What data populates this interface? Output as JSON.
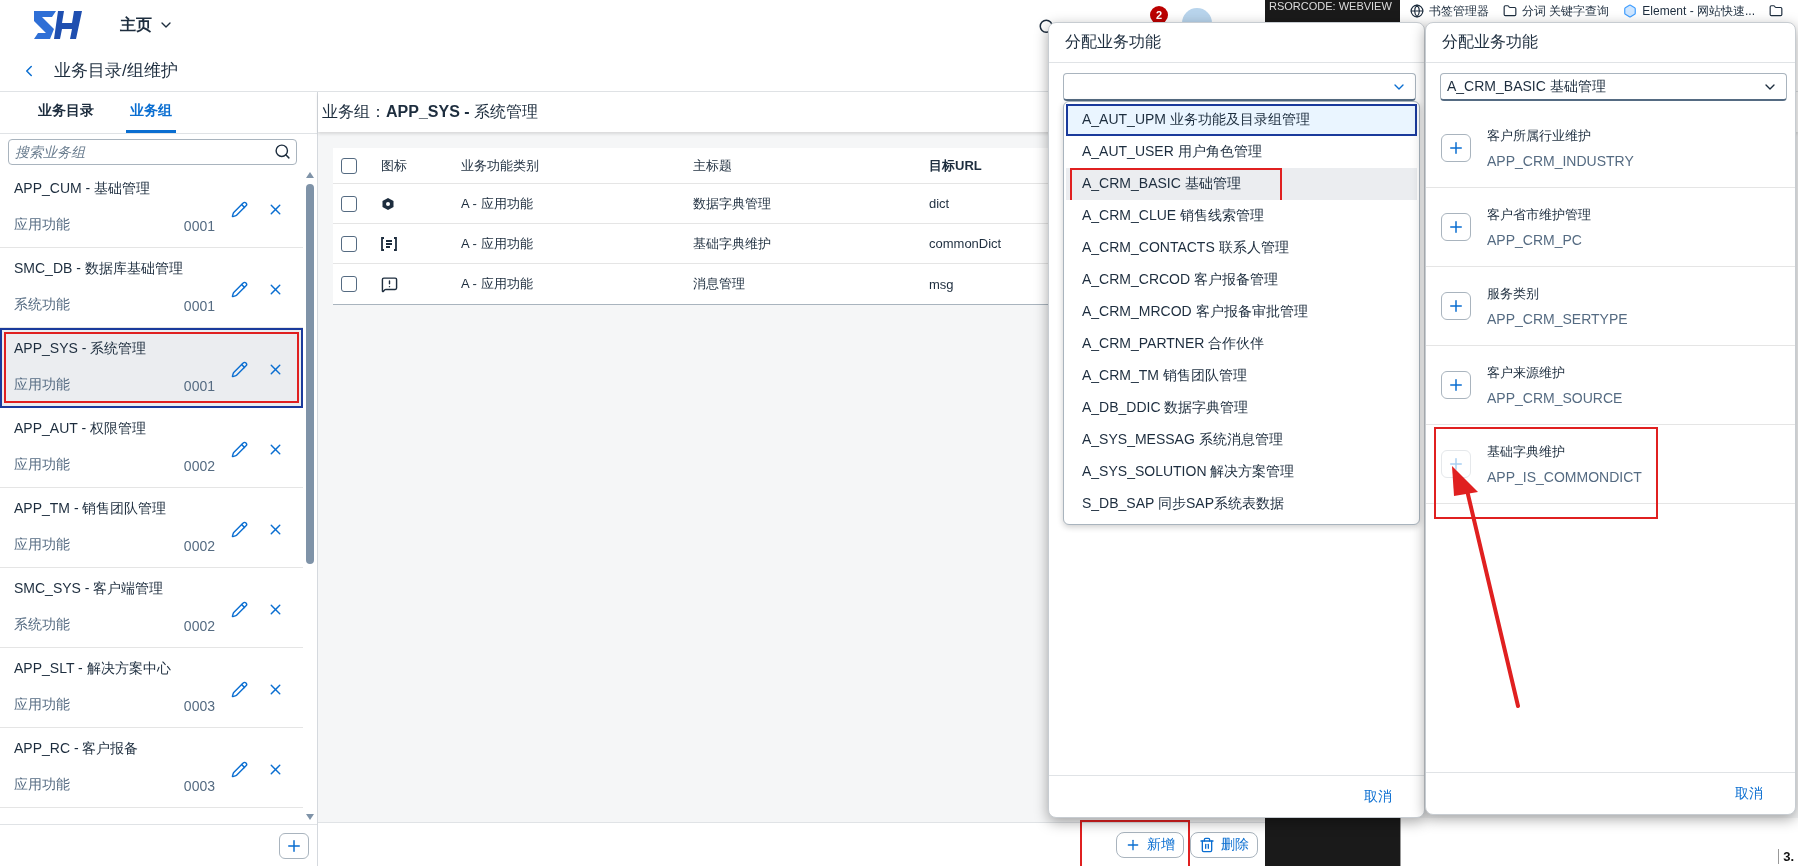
{
  "header": {
    "home_menu": "主页",
    "notification_count": "2"
  },
  "breadcrumb": "业务目录/组维护",
  "sidebar": {
    "tabs": [
      {
        "label": "业务目录",
        "selected": false
      },
      {
        "label": "业务组",
        "selected": true
      }
    ],
    "search": {
      "placeholder": "搜索业务组"
    },
    "items": [
      {
        "title": "APP_CUM - 基础管理",
        "category": "应用功能",
        "code": "0001",
        "selected": false,
        "annotated": false
      },
      {
        "title": "SMC_DB - 数据库基础管理",
        "category": "系统功能",
        "code": "0001",
        "selected": false,
        "annotated": false
      },
      {
        "title": "APP_SYS - 系统管理",
        "category": "应用功能",
        "code": "0001",
        "selected": true,
        "annotated": true
      },
      {
        "title": "APP_AUT - 权限管理",
        "category": "应用功能",
        "code": "0002",
        "selected": false,
        "annotated": false
      },
      {
        "title": "APP_TM - 销售团队管理",
        "category": "应用功能",
        "code": "0002",
        "selected": false,
        "annotated": false
      },
      {
        "title": "SMC_SYS - 客户端管理",
        "category": "系统功能",
        "code": "0002",
        "selected": false,
        "annotated": false
      },
      {
        "title": "APP_SLT - 解决方案中心",
        "category": "应用功能",
        "code": "0003",
        "selected": false,
        "annotated": false
      },
      {
        "title": "APP_RC - 客户报备",
        "category": "应用功能",
        "code": "0003",
        "selected": false,
        "annotated": false
      }
    ]
  },
  "group_header": "业务组：**APP_SYS -** 系统管理",
  "table": {
    "header_checked": false,
    "columns": [
      "图标",
      "业务功能类别",
      "主标题",
      "目标URL"
    ],
    "rows": [
      {
        "checked": false,
        "category": "A - 应用功能",
        "title": "数据字典管理",
        "url": "dict"
      },
      {
        "checked": false,
        "category": "A - 应用功能",
        "title": "基础字典维护",
        "url": "commonDict"
      },
      {
        "checked": false,
        "category": "A - 应用功能",
        "title": "消息管理",
        "url": "msg"
      }
    ]
  },
  "footer_buttons": [
    {
      "kind": "add",
      "label": "新增",
      "annotated": true
    },
    {
      "kind": "delete",
      "label": "删除",
      "annotated": false
    }
  ],
  "browser": {
    "webview_label": "RSORCODE: WEBVIEW",
    "corner_text": "3.",
    "bookmarks": [
      {
        "kind": "globe",
        "label": "书签管理器"
      },
      {
        "kind": "folder",
        "label": "分词 关键字查询"
      },
      {
        "kind": "app",
        "label": "Element - 网站快速..."
      },
      {
        "kind": "folder"
      }
    ]
  },
  "assign_dialog": {
    "title": "分配业务功能",
    "cancel": "取消",
    "options": [
      {
        "label": "A_AUT_UPM 业务功能及目录组管理",
        "selected": true,
        "hovered": false,
        "annotated": false
      },
      {
        "label": "A_AUT_USER 用户角色管理",
        "selected": false,
        "hovered": false,
        "annotated": false
      },
      {
        "label": "A_CRM_BASIC 基础管理",
        "selected": false,
        "hovered": true,
        "annotated": true
      },
      {
        "label": "A_CRM_CLUE 销售线索管理",
        "selected": false,
        "hovered": false,
        "annotated": false
      },
      {
        "label": "A_CRM_CONTACTS 联系人管理",
        "selected": false,
        "hovered": false,
        "annotated": false
      },
      {
        "label": "A_CRM_CRCOD 客户报备管理",
        "selected": false,
        "hovered": false,
        "annotated": false
      },
      {
        "label": "A_CRM_MRCOD 客户报备审批管理",
        "selected": false,
        "hovered": false,
        "annotated": false
      },
      {
        "label": "A_CRM_PARTNER 合作伙伴",
        "selected": false,
        "hovered": false,
        "annotated": false
      },
      {
        "label": "A_CRM_TM 销售团队管理",
        "selected": false,
        "hovered": false,
        "annotated": false
      },
      {
        "label": "A_DB_DDIC 数据字典管理",
        "selected": false,
        "hovered": false,
        "annotated": false
      },
      {
        "label": "A_SYS_MESSAG 系统消息管理",
        "selected": false,
        "hovered": false,
        "annotated": false
      },
      {
        "label": "A_SYS_SOLUTION 解决方案管理",
        "selected": false,
        "hovered": false,
        "annotated": false
      },
      {
        "label": "S_DB_SAP 同步SAP系统表数据",
        "selected": false,
        "hovered": false,
        "annotated": false
      }
    ]
  },
  "assign_dialog_result": {
    "title": "分配业务功能",
    "select_value": "A_CRM_BASIC 基础管理",
    "cancel": "取消",
    "items": [
      {
        "title": "客户所属行业维护",
        "code": "APP_CRM_INDUSTRY",
        "disabled": false,
        "annotated": false
      },
      {
        "title": "客户省市维护管理",
        "code": "APP_CRM_PC",
        "disabled": false,
        "annotated": false
      },
      {
        "title": "服务类别",
        "code": "APP_CRM_SERTYPE",
        "disabled": false,
        "annotated": false
      },
      {
        "title": "客户来源维护",
        "code": "APP_CRM_SOURCE",
        "disabled": false,
        "annotated": false
      },
      {
        "title": "基础字典维护",
        "code": "APP_IS_COMMONDICT",
        "disabled": true,
        "annotated": true
      }
    ]
  }
}
